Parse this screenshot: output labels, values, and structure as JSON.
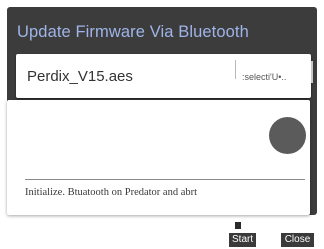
{
  "dialog": {
    "title": "Update Firmware Via Bluetooth",
    "title_color": "#9fb4e8",
    "background_color": "#3c3c3c"
  },
  "file_picker": {
    "file_name": "Perdix_V15.aes",
    "select_label": ":selecti'U•.."
  },
  "status": {
    "indicator_color": "#5b5b5b",
    "message": "Initialize. Btuatooth on Predator and abrt"
  },
  "footer": {
    "start_label": "Start",
    "close_label": "Close"
  }
}
